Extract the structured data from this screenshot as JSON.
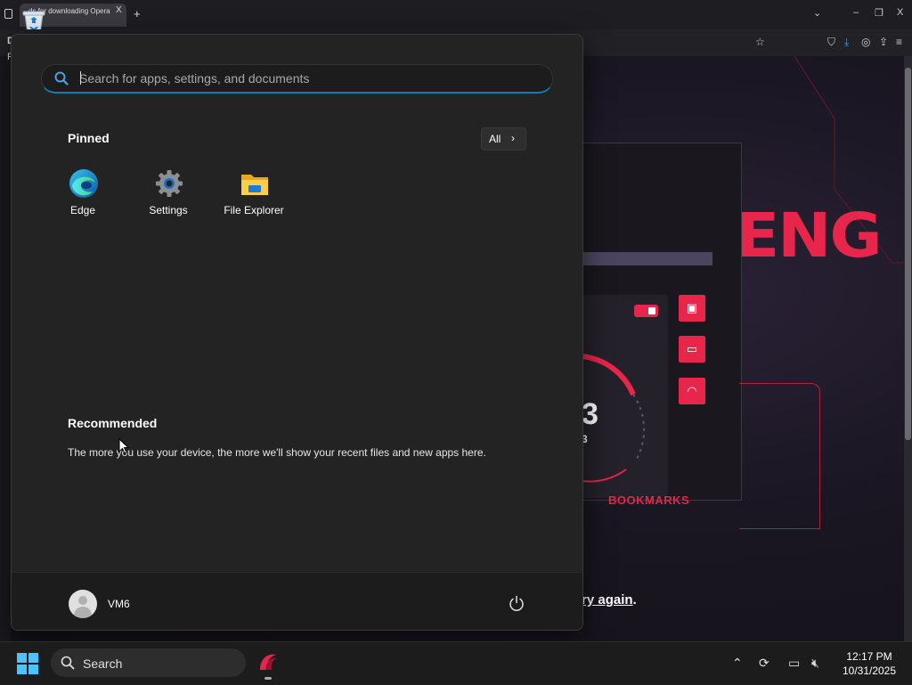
{
  "browser": {
    "tab_title": "ds for downloading Opera",
    "tab_close": "X",
    "new_tab": "+",
    "window_controls": {
      "dropdown": "⌄",
      "minimize": "–",
      "restore": "❐",
      "close": "X"
    },
    "left_letters": [
      "D",
      "F"
    ]
  },
  "webpage": {
    "headline_fragment": "ENG",
    "gauge_value": "3",
    "gauge_sub": "3",
    "bookmarks_label": "BOOKMARKS",
    "try_again": "ry again",
    "try_again_suffix": ".",
    "accent_color": "#e8254a"
  },
  "start_menu": {
    "search": {
      "placeholder": "Search for apps, settings, and documents",
      "value": ""
    },
    "pinned": {
      "title": "Pinned",
      "all_label": "All",
      "apps": [
        {
          "label": "Edge",
          "icon": "edge-icon"
        },
        {
          "label": "Settings",
          "icon": "settings-gear-icon"
        },
        {
          "label": "File Explorer",
          "icon": "folder-icon"
        }
      ]
    },
    "recommended": {
      "title": "Recommended",
      "message": "The more you use your device, the more we'll show your recent files and new apps here."
    },
    "user": {
      "name": "VM6"
    },
    "power_icon": "power-icon"
  },
  "taskbar": {
    "search_label": "Search",
    "clock": {
      "time": "12:17 PM",
      "date": "10/31/2025"
    }
  }
}
